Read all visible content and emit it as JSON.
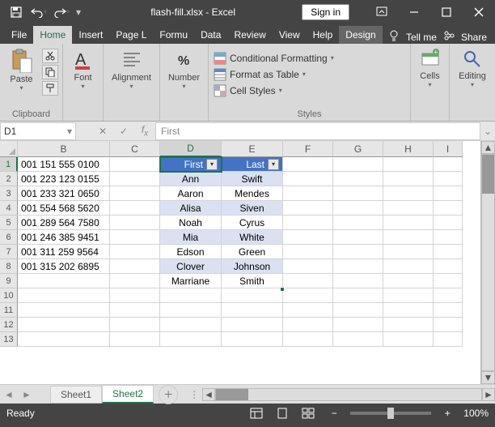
{
  "title": "flash-fill.xlsx  -  Excel",
  "signin": "Sign in",
  "tabs": {
    "file": "File",
    "home": "Home",
    "insert": "Insert",
    "pagelayout": "Page L",
    "formulas": "Formu",
    "data": "Data",
    "review": "Review",
    "view": "View",
    "help": "Help",
    "design": "Design",
    "tellme": "Tell me",
    "share": "Share"
  },
  "ribbon": {
    "clipboard": "Clipboard",
    "paste": "Paste",
    "font": "Font",
    "alignment": "Alignment",
    "number": "Number",
    "styles": "Styles",
    "cond": "Conditional Formatting",
    "table": "Format as Table",
    "cellstyles": "Cell Styles",
    "cells": "Cells",
    "editing": "Editing"
  },
  "namebox": "D1",
  "formula": "First",
  "columns": [
    "B",
    "C",
    "D",
    "E",
    "F",
    "G",
    "H",
    "I"
  ],
  "rows": [
    1,
    2,
    3,
    4,
    5,
    6,
    7,
    8,
    9,
    10,
    11,
    12,
    13
  ],
  "chart_data": {
    "type": "table",
    "headers": {
      "D": "First",
      "E": "Last"
    },
    "data": [
      {
        "B": "001 151 555 0100",
        "D": "Ann",
        "E": "Swift"
      },
      {
        "B": "001 223 123 0155",
        "D": "Aaron",
        "E": "Mendes"
      },
      {
        "B": "001 233 321 0650",
        "D": "Alisa",
        "E": "Siven"
      },
      {
        "B": "001 554 568 5620",
        "D": "Noah",
        "E": "Cyrus"
      },
      {
        "B": "001 289 564 7580",
        "D": "Mia",
        "E": "White"
      },
      {
        "B": "001 246 385 9451",
        "D": "Edson",
        "E": "Green"
      },
      {
        "B": "001 311 259 9564",
        "D": "Clover",
        "E": "Johnson"
      },
      {
        "B": "001 315 202 6895",
        "D": "Marriane",
        "E": "Smith"
      }
    ]
  },
  "sheets": {
    "s1": "Sheet1",
    "s2": "Sheet2"
  },
  "status": {
    "ready": "Ready",
    "zoom": "100%"
  }
}
